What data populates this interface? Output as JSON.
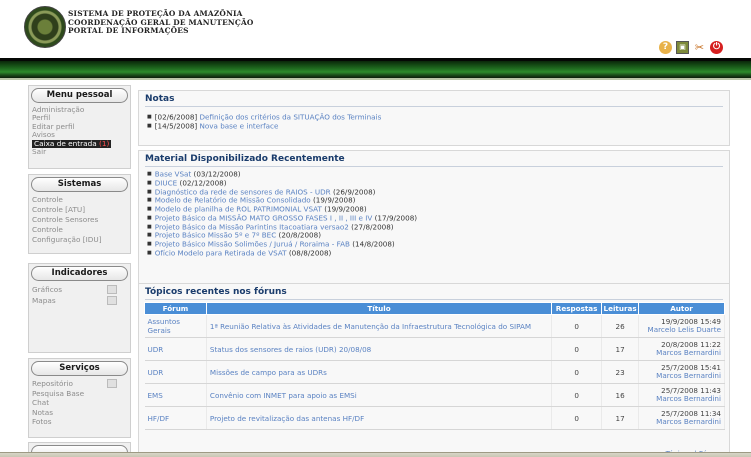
{
  "header": {
    "org_lines": [
      "SISTEMA DE PROTEÇÃO DA AMAZÔNIA",
      "COORDENAÇÃO GERAL DE MANUTENÇÃO",
      "PORTAL DE INFORMAÇÕES"
    ],
    "icons": [
      "help-icon",
      "image-icon",
      "tools-icon",
      "power-icon"
    ]
  },
  "sidebar": {
    "menu_pessoal": {
      "title": "Menu pessoal",
      "items": [
        "Administração",
        "Perfil",
        "Editar perfil",
        "Avisos"
      ],
      "inbox_label": "Caixa de entrada",
      "inbox_count": "(1)",
      "after_items": [
        "Sair"
      ]
    },
    "sistemas": {
      "title": "Sistemas",
      "items": [
        "Controle",
        "Controle [ATU]",
        "Controle Sensores",
        "Controle",
        "Configuração [IDU]"
      ]
    },
    "indicadores": {
      "title": "Indicadores",
      "items": [
        "Gráficos",
        "Mapas"
      ]
    },
    "servicos": {
      "title": "Serviços",
      "items": [
        "Repositório",
        "Pesquisa Base",
        "Chat",
        "Notas",
        "Fotos"
      ]
    }
  },
  "notas": {
    "title": "Notas",
    "items": [
      {
        "date": "[02/6/2008]",
        "text": "Definição dos critérios da SITUAÇÃO dos Terminais"
      },
      {
        "date": "[14/5/2008]",
        "text": "Nova base e interface"
      }
    ]
  },
  "material": {
    "title": "Material Disponibilizado Recentemente",
    "items": [
      {
        "text": "Base VSat",
        "date": "(03/12/2008)"
      },
      {
        "text": "DIUCE",
        "date": "(02/12/2008)"
      },
      {
        "text": "Diagnóstico da rede de sensores de RAIOS - UDR",
        "date": "(26/9/2008)"
      },
      {
        "text": "Modelo de Relatório de Missão Consolidado",
        "date": "(19/9/2008)"
      },
      {
        "text": "Modelo de planilha de ROL PATRIMONIAL VSAT",
        "date": "(19/9/2008)"
      },
      {
        "text": "Projeto Básico da MISSÃO MATO GROSSO FASES I , II , III e IV",
        "date": "(17/9/2008)"
      },
      {
        "text": "Projeto Básico da Missão Parintins Itacoatiara versao2",
        "date": "(27/8/2008)"
      },
      {
        "text": "Projeto Básico Missão 5º e 7º BEC",
        "date": "(20/8/2008)"
      },
      {
        "text": "Projeto Básico Missão Solimões / Juruá / Roraima - FAB",
        "date": "(14/8/2008)"
      },
      {
        "text": "Ofício Modelo para Retirada de VSAT",
        "date": "(08/8/2008)"
      }
    ]
  },
  "forum": {
    "title": "Tópicos recentes nos fóruns",
    "columns": [
      "Fórum",
      "Título",
      "Respostas",
      "Leituras",
      "Autor"
    ],
    "rows": [
      {
        "forum": "Assuntos Gerais",
        "titulo": "1ª Reunião Relativa às Atividades de Manutenção da Infraestrutura Tecnológica do SIPAM",
        "respostas": "0",
        "leituras": "26",
        "data": "19/9/2008 15:49",
        "autor": "Marcelo Lelis Duarte"
      },
      {
        "forum": "UDR",
        "titulo": "Status dos sensores de raios (UDR) 20/08/08",
        "respostas": "0",
        "leituras": "17",
        "data": "20/8/2008 11:22",
        "autor": "Marcos Bernardini"
      },
      {
        "forum": "UDR",
        "titulo": "Missões de campo para as UDRs",
        "respostas": "0",
        "leituras": "23",
        "data": "25/7/2008 15:41",
        "autor": "Marcos Bernardini"
      },
      {
        "forum": "EMS",
        "titulo": "Convênio com INMET para apoio as EMSi",
        "respostas": "0",
        "leituras": "16",
        "data": "25/7/2008 11:43",
        "autor": "Marcos Bernardini"
      },
      {
        "forum": "HF/DF",
        "titulo": "Projeto de revitalização das antenas HF/DF",
        "respostas": "0",
        "leituras": "17",
        "data": "25/7/2008 11:34",
        "autor": "Marcos Bernardini"
      }
    ],
    "footer_links": [
      "Tópicos",
      "Fóruns"
    ]
  }
}
